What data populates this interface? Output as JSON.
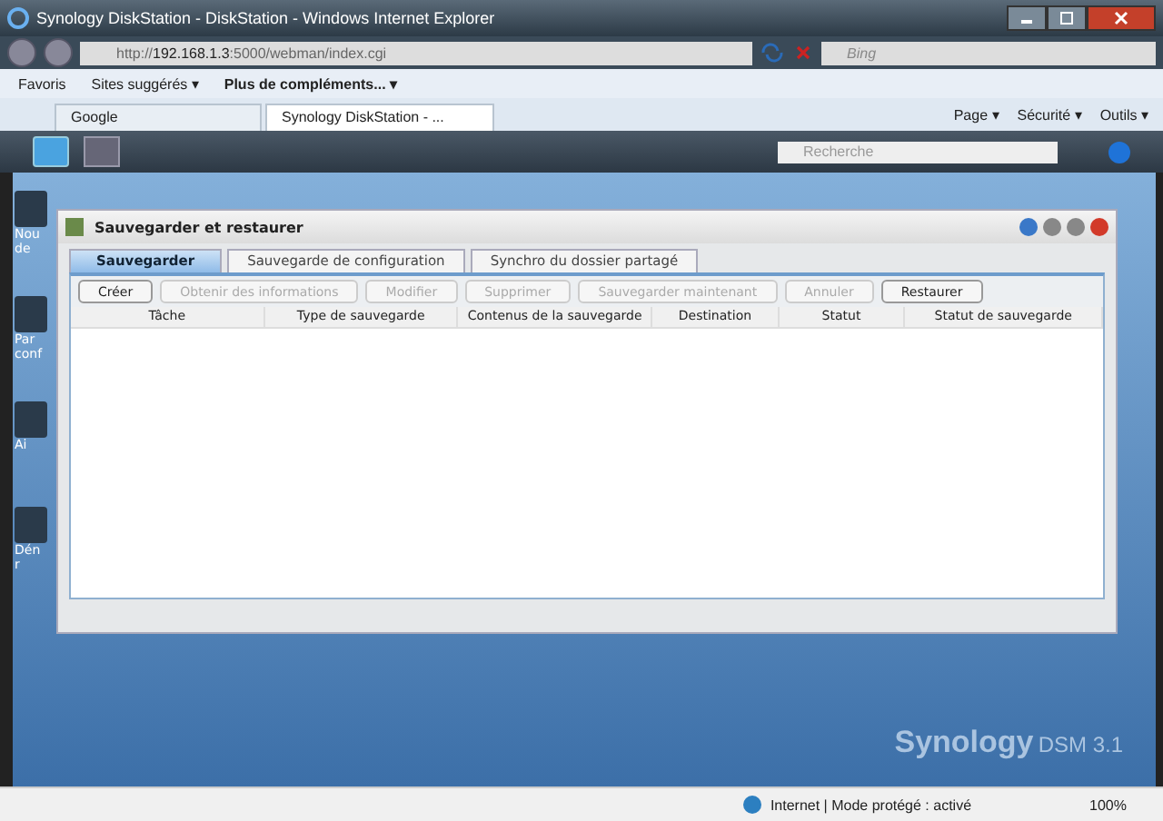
{
  "window": {
    "title": "Synology DiskStation - DiskStation - Windows Internet Explorer"
  },
  "address_bar": {
    "url_prefix": "http://",
    "url_host": "192.168.1.3",
    "url_rest": ":5000/webman/index.cgi",
    "search_placeholder": "Bing"
  },
  "favorites_bar": {
    "items": [
      {
        "label": "Favoris",
        "bold": false
      },
      {
        "label": "Sites suggérés ▾",
        "bold": false
      },
      {
        "label": "Plus de compléments... ▾",
        "bold": true
      }
    ]
  },
  "browser_tabs": [
    {
      "label": "Google",
      "selected": false
    },
    {
      "label": "Synology DiskStation - ...",
      "selected": true
    }
  ],
  "command_bar": [
    "Page ▾",
    "Sécurité ▾",
    "Outils ▾"
  ],
  "dsm_taskbar": {
    "search_placeholder": "Recherche"
  },
  "desktop_icons": [
    {
      "lines": [
        "Nou",
        "de"
      ]
    },
    {
      "lines": [
        "Par",
        "conf"
      ]
    },
    {
      "lines": [
        "Ai"
      ]
    },
    {
      "lines": [
        "Dén",
        "r"
      ]
    }
  ],
  "app_window": {
    "title": "Sauvegarder et restaurer",
    "tabs": [
      {
        "label": "Sauvegarder",
        "selected": true
      },
      {
        "label": "Sauvegarde de configuration",
        "selected": false
      },
      {
        "label": "Synchro du dossier partagé",
        "selected": false
      }
    ],
    "toolbar": [
      {
        "label": "Créer",
        "disabled": false
      },
      {
        "label": "Obtenir des informations",
        "disabled": true
      },
      {
        "label": "Modifier",
        "disabled": true
      },
      {
        "label": "Supprimer",
        "disabled": true
      },
      {
        "label": "Sauvegarder maintenant",
        "disabled": true
      },
      {
        "label": "Annuler",
        "disabled": true
      },
      {
        "label": "Restaurer",
        "disabled": false
      }
    ],
    "table": {
      "columns": [
        "Tâche",
        "Type de sauvegarde",
        "Contenus de la sauvegarde",
        "Destination",
        "Statut",
        "Statut de sauvegarde"
      ]
    }
  },
  "logo": {
    "brand": "Synology",
    "product": "DSM 3.1"
  },
  "status_bar": {
    "zone": "Internet | Mode protégé : activé",
    "zoom": "100%"
  }
}
